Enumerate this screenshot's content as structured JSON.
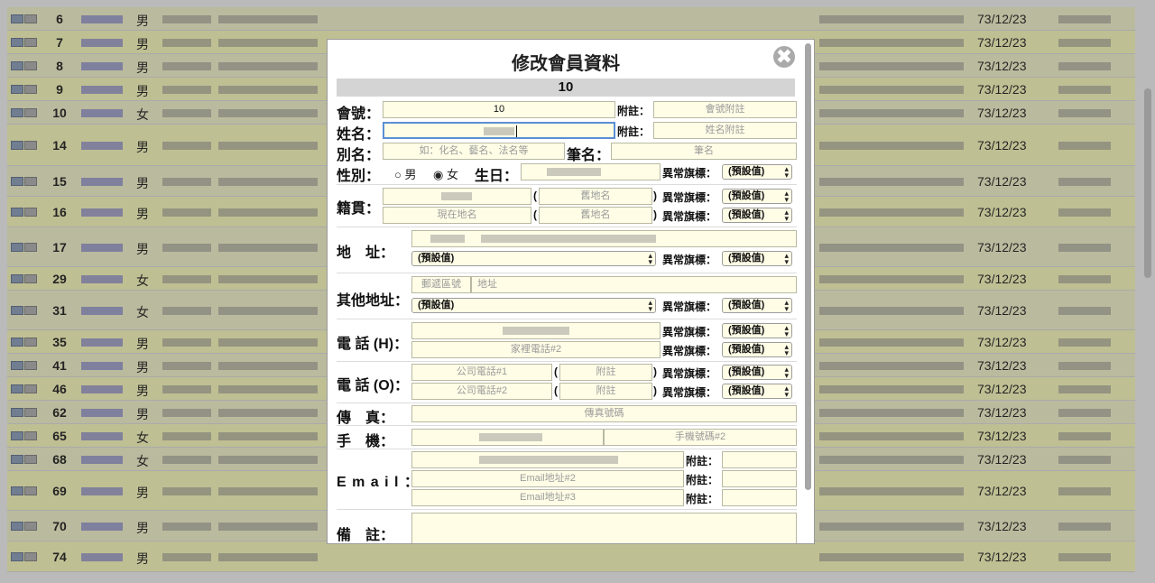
{
  "background_rows": [
    {
      "num": "6",
      "sex": "男",
      "date": "73/12/23"
    },
    {
      "num": "7",
      "sex": "男",
      "date": "73/12/23"
    },
    {
      "num": "8",
      "sex": "男",
      "date": "73/12/23"
    },
    {
      "num": "9",
      "sex": "男",
      "date": "73/12/23"
    },
    {
      "num": "10",
      "sex": "女",
      "date": "73/12/23"
    },
    {
      "num": "14",
      "sex": "男",
      "date": "73/12/23"
    },
    {
      "num": "15",
      "sex": "男",
      "date": "73/12/23"
    },
    {
      "num": "16",
      "sex": "男",
      "date": "73/12/23"
    },
    {
      "num": "17",
      "sex": "男",
      "date": "73/12/23"
    },
    {
      "num": "29",
      "sex": "女",
      "date": "73/12/23"
    },
    {
      "num": "31",
      "sex": "女",
      "date": "73/12/23"
    },
    {
      "num": "35",
      "sex": "男",
      "date": "73/12/23"
    },
    {
      "num": "41",
      "sex": "男",
      "date": "73/12/23"
    },
    {
      "num": "46",
      "sex": "男",
      "date": "73/12/23"
    },
    {
      "num": "62",
      "sex": "男",
      "date": "73/12/23"
    },
    {
      "num": "65",
      "sex": "女",
      "date": "73/12/23"
    },
    {
      "num": "68",
      "sex": "女",
      "date": "73/12/23"
    },
    {
      "num": "69",
      "sex": "男",
      "date": "73/12/23"
    },
    {
      "num": "70",
      "sex": "男",
      "date": "73/12/23"
    },
    {
      "num": "74",
      "sex": "男",
      "date": "73/12/23"
    }
  ],
  "modal": {
    "title": "修改會員資料",
    "close_icon": "✖",
    "member_id": "10",
    "labels": {
      "member_no": "會號：",
      "note": "附註：",
      "name": "姓名：",
      "alias": "別名：",
      "pen_name": "筆名：",
      "gender": "性別：",
      "male": "男",
      "female": "女",
      "birthday": "生日：",
      "flag": "異常旗標：",
      "native": "籍貫：",
      "address": "地　址：",
      "other_address": "其他地址：",
      "phone_home": "電 話 (H)：",
      "phone_office": "電 話 (O)：",
      "fax": "傳　真：",
      "mobile": "手　機：",
      "email": "E m a i l ：",
      "remarks": "備　註："
    },
    "fields": {
      "member_no_value": "10",
      "member_no_note_placeholder": "會號附註",
      "name_note_placeholder": "姓名附註",
      "alias_placeholder": "如：化名、藝名、法名等",
      "pen_name_placeholder": "筆名",
      "native_old_placeholder": "舊地名",
      "native_current_placeholder": "現在地名",
      "native_old2_placeholder": "舊地名",
      "other_zip_placeholder": "郵遞區號",
      "other_addr_placeholder": "地址",
      "phone_home2_placeholder": "家裡電話#2",
      "office1_placeholder": "公司電話#1",
      "office1_note_placeholder": "附註",
      "office2_placeholder": "公司電話#2",
      "office2_note_placeholder": "附註",
      "fax_placeholder": "傳真號碼",
      "mobile2_placeholder": "手機號碼#2",
      "email2_placeholder": "Email地址#2",
      "email3_placeholder": "Email地址#3",
      "paren_open": "(",
      "paren_close": ")"
    },
    "select_default": "(預設值)",
    "gender_selected": "女"
  }
}
